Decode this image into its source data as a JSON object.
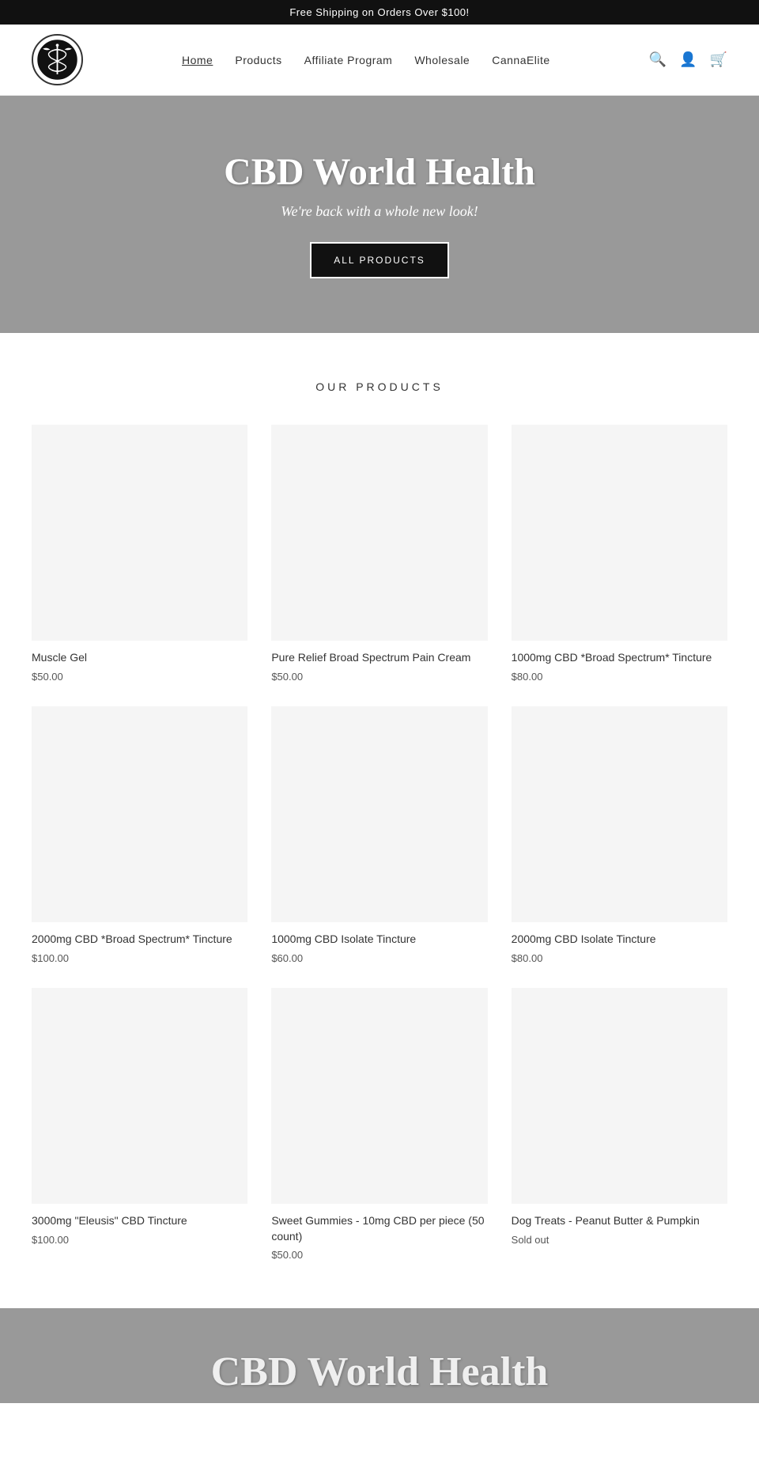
{
  "announcement": {
    "text": "Free Shipping on Orders Over $100!"
  },
  "header": {
    "logo_alt": "CBD World Health Logo",
    "nav_items": [
      {
        "label": "Home",
        "active": true
      },
      {
        "label": "Products",
        "active": false
      },
      {
        "label": "Affiliate Program",
        "active": false
      },
      {
        "label": "Wholesale",
        "active": false
      },
      {
        "label": "CannaElite",
        "active": false
      }
    ],
    "search_icon": "🔍",
    "login_icon": "👤",
    "cart_icon": "🛒"
  },
  "hero": {
    "title": "CBD World Health",
    "subtitle": "We're back with a whole new look!",
    "button_label": "ALL PRODUCTS"
  },
  "products_section": {
    "heading": "OUR PRODUCTS",
    "products": [
      {
        "name": "Muscle Gel",
        "price": "$50.00",
        "sold_out": false
      },
      {
        "name": "Pure Relief Broad Spectrum Pain Cream",
        "price": "$50.00",
        "sold_out": false
      },
      {
        "name": "1000mg CBD *Broad Spectrum* Tincture",
        "price": "$80.00",
        "sold_out": false
      },
      {
        "name": "2000mg CBD *Broad Spectrum* Tincture",
        "price": "$100.00",
        "sold_out": false
      },
      {
        "name": "1000mg CBD Isolate Tincture",
        "price": "$60.00",
        "sold_out": false
      },
      {
        "name": "2000mg CBD Isolate Tincture",
        "price": "$80.00",
        "sold_out": false
      },
      {
        "name": "3000mg \"Eleusis\" CBD Tincture",
        "price": "$100.00",
        "sold_out": false
      },
      {
        "name": "Sweet Gummies - 10mg CBD per piece (50 count)",
        "price": "$50.00",
        "sold_out": false
      },
      {
        "name": "Dog Treats - Peanut Butter & Pumpkin",
        "price": "Sold out",
        "sold_out": true
      }
    ]
  },
  "footer_banner": {
    "title": "CBD World Health"
  }
}
